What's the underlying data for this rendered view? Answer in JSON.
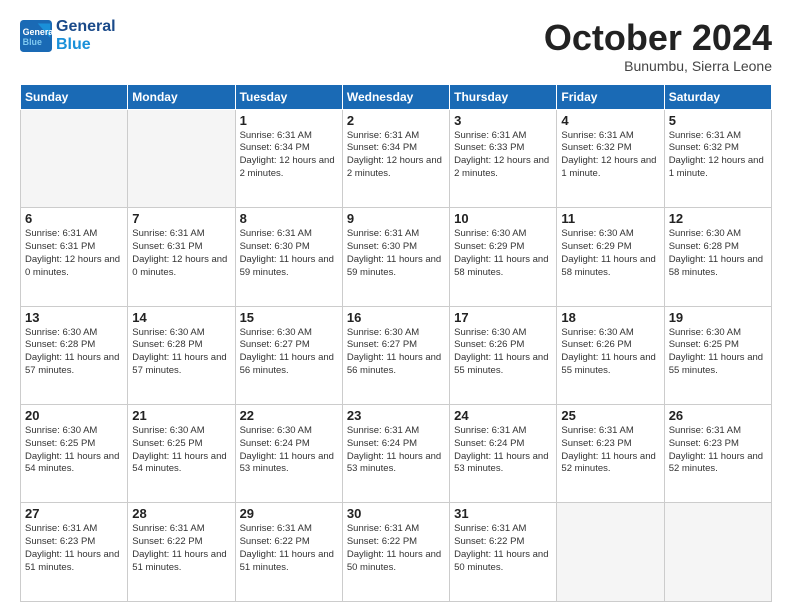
{
  "header": {
    "logo_line1": "General",
    "logo_line2": "Blue",
    "month": "October 2024",
    "location": "Bunumbu, Sierra Leone"
  },
  "days_of_week": [
    "Sunday",
    "Monday",
    "Tuesday",
    "Wednesday",
    "Thursday",
    "Friday",
    "Saturday"
  ],
  "weeks": [
    [
      {
        "day": "",
        "info": ""
      },
      {
        "day": "",
        "info": ""
      },
      {
        "day": "1",
        "info": "Sunrise: 6:31 AM\nSunset: 6:34 PM\nDaylight: 12 hours and 2 minutes."
      },
      {
        "day": "2",
        "info": "Sunrise: 6:31 AM\nSunset: 6:34 PM\nDaylight: 12 hours and 2 minutes."
      },
      {
        "day": "3",
        "info": "Sunrise: 6:31 AM\nSunset: 6:33 PM\nDaylight: 12 hours and 2 minutes."
      },
      {
        "day": "4",
        "info": "Sunrise: 6:31 AM\nSunset: 6:32 PM\nDaylight: 12 hours and 1 minute."
      },
      {
        "day": "5",
        "info": "Sunrise: 6:31 AM\nSunset: 6:32 PM\nDaylight: 12 hours and 1 minute."
      }
    ],
    [
      {
        "day": "6",
        "info": "Sunrise: 6:31 AM\nSunset: 6:31 PM\nDaylight: 12 hours and 0 minutes."
      },
      {
        "day": "7",
        "info": "Sunrise: 6:31 AM\nSunset: 6:31 PM\nDaylight: 12 hours and 0 minutes."
      },
      {
        "day": "8",
        "info": "Sunrise: 6:31 AM\nSunset: 6:30 PM\nDaylight: 11 hours and 59 minutes."
      },
      {
        "day": "9",
        "info": "Sunrise: 6:31 AM\nSunset: 6:30 PM\nDaylight: 11 hours and 59 minutes."
      },
      {
        "day": "10",
        "info": "Sunrise: 6:30 AM\nSunset: 6:29 PM\nDaylight: 11 hours and 58 minutes."
      },
      {
        "day": "11",
        "info": "Sunrise: 6:30 AM\nSunset: 6:29 PM\nDaylight: 11 hours and 58 minutes."
      },
      {
        "day": "12",
        "info": "Sunrise: 6:30 AM\nSunset: 6:28 PM\nDaylight: 11 hours and 58 minutes."
      }
    ],
    [
      {
        "day": "13",
        "info": "Sunrise: 6:30 AM\nSunset: 6:28 PM\nDaylight: 11 hours and 57 minutes."
      },
      {
        "day": "14",
        "info": "Sunrise: 6:30 AM\nSunset: 6:28 PM\nDaylight: 11 hours and 57 minutes."
      },
      {
        "day": "15",
        "info": "Sunrise: 6:30 AM\nSunset: 6:27 PM\nDaylight: 11 hours and 56 minutes."
      },
      {
        "day": "16",
        "info": "Sunrise: 6:30 AM\nSunset: 6:27 PM\nDaylight: 11 hours and 56 minutes."
      },
      {
        "day": "17",
        "info": "Sunrise: 6:30 AM\nSunset: 6:26 PM\nDaylight: 11 hours and 55 minutes."
      },
      {
        "day": "18",
        "info": "Sunrise: 6:30 AM\nSunset: 6:26 PM\nDaylight: 11 hours and 55 minutes."
      },
      {
        "day": "19",
        "info": "Sunrise: 6:30 AM\nSunset: 6:25 PM\nDaylight: 11 hours and 55 minutes."
      }
    ],
    [
      {
        "day": "20",
        "info": "Sunrise: 6:30 AM\nSunset: 6:25 PM\nDaylight: 11 hours and 54 minutes."
      },
      {
        "day": "21",
        "info": "Sunrise: 6:30 AM\nSunset: 6:25 PM\nDaylight: 11 hours and 54 minutes."
      },
      {
        "day": "22",
        "info": "Sunrise: 6:30 AM\nSunset: 6:24 PM\nDaylight: 11 hours and 53 minutes."
      },
      {
        "day": "23",
        "info": "Sunrise: 6:31 AM\nSunset: 6:24 PM\nDaylight: 11 hours and 53 minutes."
      },
      {
        "day": "24",
        "info": "Sunrise: 6:31 AM\nSunset: 6:24 PM\nDaylight: 11 hours and 53 minutes."
      },
      {
        "day": "25",
        "info": "Sunrise: 6:31 AM\nSunset: 6:23 PM\nDaylight: 11 hours and 52 minutes."
      },
      {
        "day": "26",
        "info": "Sunrise: 6:31 AM\nSunset: 6:23 PM\nDaylight: 11 hours and 52 minutes."
      }
    ],
    [
      {
        "day": "27",
        "info": "Sunrise: 6:31 AM\nSunset: 6:23 PM\nDaylight: 11 hours and 51 minutes."
      },
      {
        "day": "28",
        "info": "Sunrise: 6:31 AM\nSunset: 6:22 PM\nDaylight: 11 hours and 51 minutes."
      },
      {
        "day": "29",
        "info": "Sunrise: 6:31 AM\nSunset: 6:22 PM\nDaylight: 11 hours and 51 minutes."
      },
      {
        "day": "30",
        "info": "Sunrise: 6:31 AM\nSunset: 6:22 PM\nDaylight: 11 hours and 50 minutes."
      },
      {
        "day": "31",
        "info": "Sunrise: 6:31 AM\nSunset: 6:22 PM\nDaylight: 11 hours and 50 minutes."
      },
      {
        "day": "",
        "info": ""
      },
      {
        "day": "",
        "info": ""
      }
    ]
  ]
}
